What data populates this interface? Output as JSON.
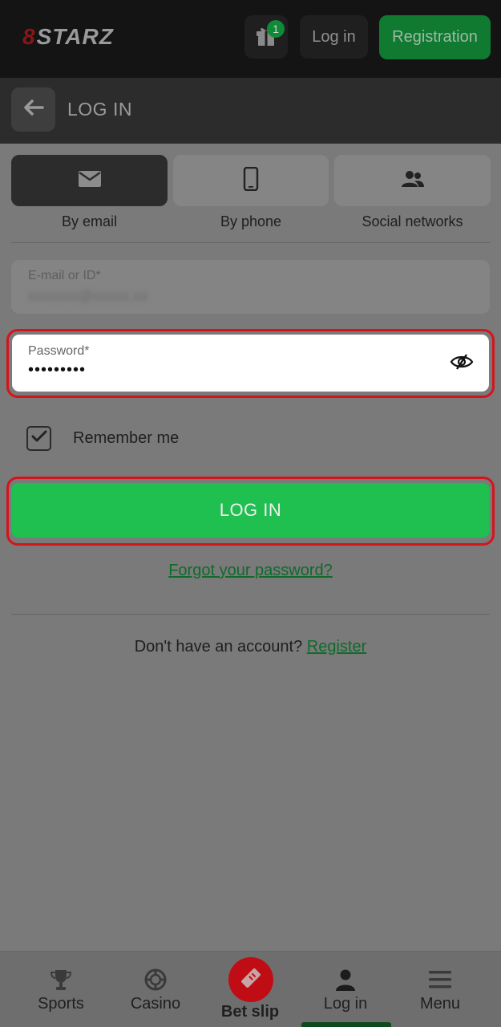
{
  "header": {
    "logo_mark": "8",
    "logo_text": "STARZ",
    "gift_badge": "1",
    "login_button": "Log in",
    "registration_button": "Registration"
  },
  "page": {
    "title": "LOG IN"
  },
  "tabs": [
    {
      "label": "By email",
      "icon": "envelope-icon",
      "active": true
    },
    {
      "label": "By phone",
      "icon": "phone-icon",
      "active": false
    },
    {
      "label": "Social networks",
      "icon": "people-icon",
      "active": false
    }
  ],
  "form": {
    "email_label": "E-mail or ID*",
    "email_value": "xxxxxxx@xxxxx.xx",
    "password_label": "Password*",
    "password_value": "•••••••••",
    "remember_label": "Remember me",
    "remember_checked": true,
    "submit_label": "LOG IN",
    "forgot_link": "Forgot your password?",
    "no_account_text": "Don't have an account?",
    "register_link": "Register"
  },
  "bottom_nav": [
    {
      "label": "Sports",
      "icon": "trophy-icon"
    },
    {
      "label": "Casino",
      "icon": "casino-chip-icon"
    },
    {
      "label": "Bet slip",
      "icon": "ticket-icon"
    },
    {
      "label": "Log in",
      "icon": "user-icon",
      "active": true
    },
    {
      "label": "Menu",
      "icon": "hamburger-icon"
    }
  ],
  "colors": {
    "accent_green": "#1fbf50",
    "highlight_red": "#d4141c",
    "betslip_red": "#c00d15"
  }
}
